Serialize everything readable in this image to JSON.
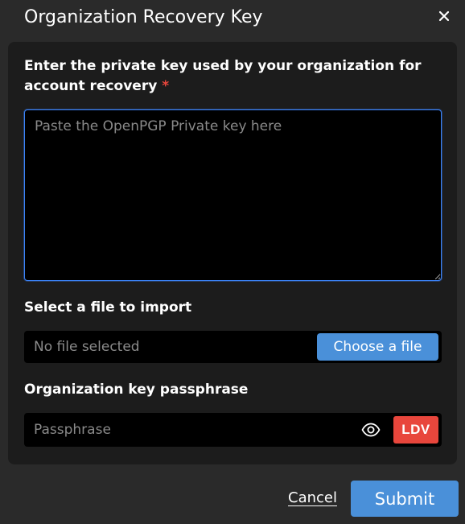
{
  "dialog": {
    "title": "Organization Recovery Key",
    "close_icon": "close-icon"
  },
  "private_key": {
    "label": "Enter the private key used by your organization for account recovery",
    "required_mark": "*",
    "placeholder": "Paste the OpenPGP Private key here",
    "value": ""
  },
  "file_import": {
    "label": "Select a file to import",
    "status": "No file selected",
    "button_label": "Choose a file"
  },
  "passphrase": {
    "label": "Organization key passphrase",
    "placeholder": "Passphrase",
    "value": "",
    "visibility_icon": "eye-icon",
    "security_token": "LDV"
  },
  "footer": {
    "cancel_label": "Cancel",
    "submit_label": "Submit"
  },
  "colors": {
    "background": "#2a2a2a",
    "panel": "#1c1c1c",
    "field": "#000000",
    "accent": "#4a90d9",
    "focus_border": "#3b82f6",
    "required": "#e8463c",
    "security_token": "#e8463c"
  }
}
